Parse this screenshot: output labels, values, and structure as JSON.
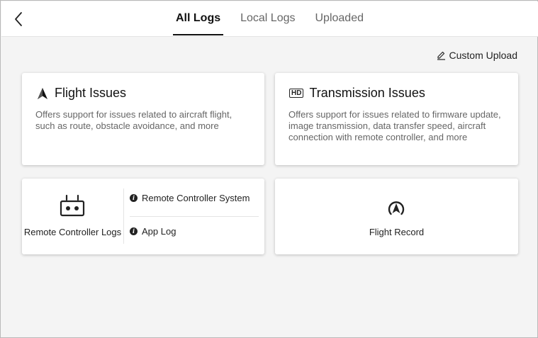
{
  "header": {
    "tabs": [
      {
        "label": "All Logs",
        "active": true
      },
      {
        "label": "Local Logs",
        "active": false
      },
      {
        "label": "Uploaded",
        "active": false
      }
    ]
  },
  "toolbar": {
    "custom_upload_label": "Custom Upload"
  },
  "cards": {
    "flight": {
      "title": "Flight Issues",
      "description": "Offers support for issues related to aircraft flight, such as route, obstacle avoidance, and more",
      "icon": "aircraft-arrow-icon"
    },
    "transmission": {
      "badge": "HD",
      "title": "Transmission Issues",
      "description": "Offers support for issues related to firmware update, image transmission, data transfer speed, aircraft connection with remote controller, and more"
    },
    "remote_controller": {
      "label": "Remote Controller Logs",
      "items": [
        {
          "label": "Remote Controller System"
        },
        {
          "label": "App Log"
        }
      ]
    },
    "flight_record": {
      "label": "Flight Record"
    }
  },
  "colors": {
    "background": "#f4f4f4",
    "card": "#ffffff",
    "text_primary": "#111111",
    "text_secondary": "#666666"
  }
}
